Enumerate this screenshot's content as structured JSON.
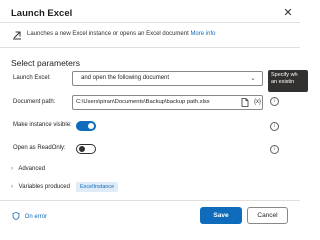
{
  "dialog": {
    "title": "Launch Excel",
    "close_icon": "close-icon",
    "description": "Launches a new Excel instance or opens an Excel document",
    "more_info": "More info",
    "section_title": "Select parameters"
  },
  "params": {
    "launch_excel": {
      "label": "Launch Excel:",
      "value": "and open the following document",
      "tooltip": "Specify wh an existin"
    },
    "document_path": {
      "label": "Document path:",
      "value": "C:\\Users\\piran\\Documents\\Backup\\backup path.xlsx",
      "var_icon": "{x}"
    },
    "make_visible": {
      "label": "Make instance visible:",
      "checked": true
    },
    "read_only": {
      "label": "Open as ReadOnly:",
      "checked": false
    }
  },
  "sections": {
    "advanced": "Advanced",
    "variables_produced": "Variables produced",
    "variable_pill": "ExcelInstance"
  },
  "footer": {
    "on_error": "On error",
    "save": "Save",
    "cancel": "Cancel"
  },
  "colors": {
    "accent": "#0f6cbd",
    "pill_bg": "#dfecf7",
    "border": "#8a8886"
  }
}
